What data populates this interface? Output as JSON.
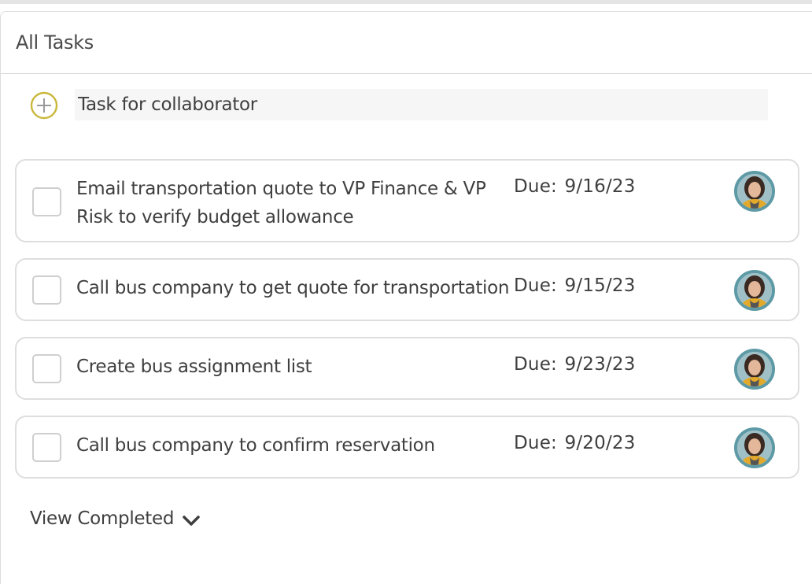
{
  "panel": {
    "title": "All Tasks"
  },
  "add_task": {
    "placeholder": "Task for collaborator"
  },
  "tasks": [
    {
      "title": "Email transportation quote to VP Finance & VP Risk to verify budget allowance",
      "due": "Due: 9/16/23"
    },
    {
      "title": "Call bus company to get quote for transportation",
      "due": "Due: 9/15/23"
    },
    {
      "title": "Create bus assignment list",
      "due": "Due: 9/23/23"
    },
    {
      "title": "Call bus company to confirm reservation",
      "due": "Due: 9/20/23"
    }
  ],
  "footer": {
    "view_completed_label": "View Completed"
  },
  "icons": {
    "add": "plus-circle-icon",
    "expand": "chevron-down-icon",
    "assignee": "avatar"
  },
  "colors": {
    "add_icon": "#c9b83a",
    "avatar_ring": "#5e9aa6",
    "checkbox_border": "#cfcfcf",
    "card_border": "#dedede"
  }
}
